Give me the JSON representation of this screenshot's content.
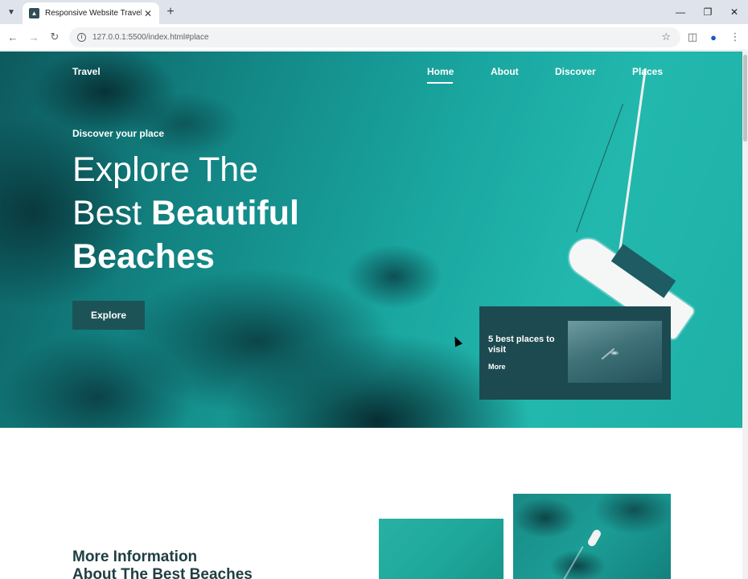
{
  "browser": {
    "tab_title": "Responsive Website Travel",
    "url": "127.0.0.1:5500/index.html#place",
    "icons": {
      "tab_menu": "chevron-down-icon",
      "favicon": "site-favicon",
      "close": "close-icon",
      "new_tab": "plus-icon",
      "back": "arrow-left-icon",
      "forward": "arrow-right-icon",
      "reload": "reload-icon",
      "info": "info-icon",
      "bookmark": "star-icon",
      "side_panel": "side-panel-icon",
      "profile": "profile-icon",
      "menu": "more-vert-icon",
      "minimize": "minimize-icon",
      "restore": "restore-icon",
      "window_close": "close-icon"
    }
  },
  "nav": {
    "logo": "Travel",
    "links": [
      "Home",
      "About",
      "Discover",
      "Places"
    ],
    "active": "Home"
  },
  "hero": {
    "subtitle": "Discover your place",
    "title_light_1": "Explore The",
    "title_light_2": "Best ",
    "title_bold_2": "Beautiful",
    "title_bold_3": "Beaches",
    "button": "Explore"
  },
  "card": {
    "title": "5 best places to visit",
    "more": "More"
  },
  "info": {
    "heading_1": "More Information",
    "heading_2": "About The Best Beaches"
  },
  "colors": {
    "accent_dark": "#1c5357",
    "card_bg": "#1c4a50",
    "heading": "#1f3e42",
    "tabbar_bg": "#dfe3eb"
  }
}
